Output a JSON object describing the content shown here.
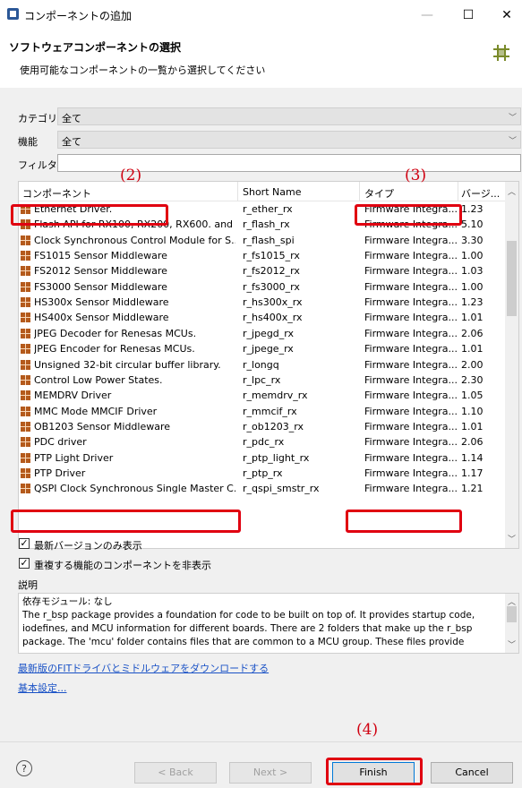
{
  "window": {
    "title": "コンポーネントの追加",
    "minimize": "—",
    "maximize": "☐",
    "close": "✕"
  },
  "header": {
    "title": "ソフトウェアコンポーネントの選択",
    "subtitle": "使用可能なコンポーネントの一覧から選択してください",
    "icon": "component-grid-icon"
  },
  "category": {
    "label": "カテゴリ",
    "value": "全て"
  },
  "function": {
    "label": "機能",
    "value": "全て"
  },
  "filter": {
    "label": "フィルタ",
    "value": ""
  },
  "table": {
    "columns": [
      "コンポーネント",
      "Short Name",
      "タイプ",
      "バージ..."
    ],
    "rows": [
      {
        "name": "Ethernet Driver.",
        "short": "r_ether_rx",
        "type": "Firmware Integra...",
        "version": "1.23"
      },
      {
        "name": "Flash API for RX100, RX200, RX600. and ...",
        "short": "r_flash_rx",
        "type": "Firmware Integra...",
        "version": "5.10"
      },
      {
        "name": "Clock Synchronous Control Module for S...",
        "short": "r_flash_spi",
        "type": "Firmware Integra...",
        "version": "3.30"
      },
      {
        "name": "FS1015 Sensor Middleware",
        "short": "r_fs1015_rx",
        "type": "Firmware Integra...",
        "version": "1.00"
      },
      {
        "name": "FS2012 Sensor Middleware",
        "short": "r_fs2012_rx",
        "type": "Firmware Integra...",
        "version": "1.03"
      },
      {
        "name": "FS3000 Sensor Middleware",
        "short": "r_fs3000_rx",
        "type": "Firmware Integra...",
        "version": "1.00"
      },
      {
        "name": "HS300x Sensor Middleware",
        "short": "r_hs300x_rx",
        "type": "Firmware Integra...",
        "version": "1.23"
      },
      {
        "name": "HS400x Sensor Middleware",
        "short": "r_hs400x_rx",
        "type": "Firmware Integra...",
        "version": "1.01"
      },
      {
        "name": "JPEG Decoder for Renesas MCUs.",
        "short": "r_jpegd_rx",
        "type": "Firmware Integra...",
        "version": "2.06"
      },
      {
        "name": "JPEG Encoder for Renesas MCUs.",
        "short": "r_jpege_rx",
        "type": "Firmware Integra...",
        "version": "1.01"
      },
      {
        "name": "Unsigned 32-bit circular buffer library.",
        "short": "r_longq",
        "type": "Firmware Integra...",
        "version": "2.00"
      },
      {
        "name": "Control Low Power States.",
        "short": "r_lpc_rx",
        "type": "Firmware Integra...",
        "version": "2.30"
      },
      {
        "name": "MEMDRV Driver",
        "short": "r_memdrv_rx",
        "type": "Firmware Integra...",
        "version": "1.05"
      },
      {
        "name": "MMC Mode MMCIF Driver",
        "short": "r_mmcif_rx",
        "type": "Firmware Integra...",
        "version": "1.10"
      },
      {
        "name": "OB1203 Sensor Middleware",
        "short": "r_ob1203_rx",
        "type": "Firmware Integra...",
        "version": "1.01"
      },
      {
        "name": "PDC driver",
        "short": "r_pdc_rx",
        "type": "Firmware Integra...",
        "version": "2.06"
      },
      {
        "name": "PTP Light Driver",
        "short": "r_ptp_light_rx",
        "type": "Firmware Integra...",
        "version": "1.14"
      },
      {
        "name": "PTP Driver",
        "short": "r_ptp_rx",
        "type": "Firmware Integra...",
        "version": "1.17"
      },
      {
        "name": "QSPI Clock Synchronous Single Master C...",
        "short": "r_qspi_smstr_rx",
        "type": "Firmware Integra...",
        "version": "1.21"
      }
    ]
  },
  "options": {
    "latest_only": "最新バージョンのみ表示",
    "hide_duplicates": "重複する機能のコンポーネントを非表示"
  },
  "description": {
    "label": "説明",
    "text": "依存モジュール: なし\nThe r_bsp package provides a foundation for code to be built on top of. It provides startup code, iodefines, and MCU information for different boards. There are 2 folders that make up the r_bsp package. The 'mcu' folder contains files that are common to a MCU group. These files provide"
  },
  "links": {
    "download": "最新版のFITドライバとミドルウェアをダウンロードする",
    "settings": "基本設定..."
  },
  "buttons": {
    "help": "?",
    "back": "< Back",
    "next": "Next >",
    "finish": "Finish",
    "cancel": "Cancel"
  },
  "annotations": {
    "a2": "(2)",
    "a3": "(3)",
    "a4": "(4)"
  },
  "colors": {
    "highlight": "#e00010",
    "link": "#1a52c6"
  }
}
